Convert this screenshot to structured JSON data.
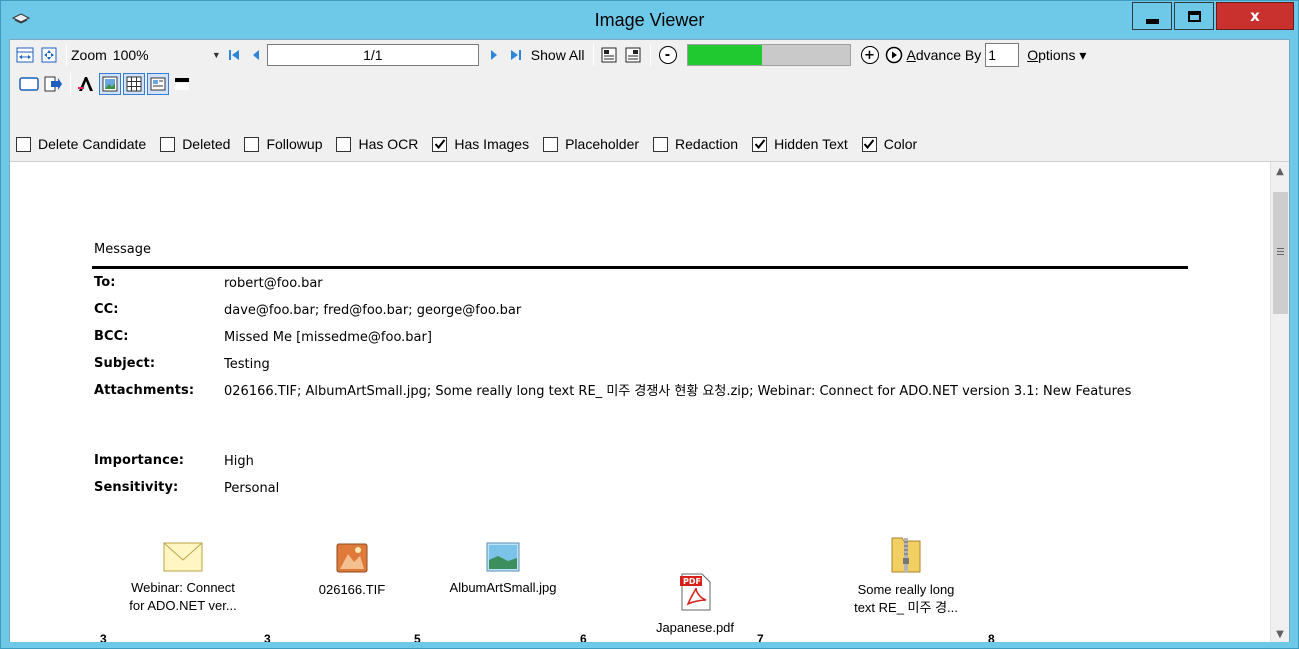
{
  "window": {
    "title": "Image Viewer",
    "close_glyph": "x"
  },
  "toolbar": {
    "zoom_label": "Zoom",
    "zoom_value": "100%",
    "page_value": "1/1",
    "show_all_label": "Show All",
    "zoom_out_glyph": "-",
    "zoom_in_glyph": "+",
    "progress_fraction": 0.46,
    "advance_label_first": "A",
    "advance_label_rest": "dvance By",
    "advance_value": "1",
    "options_label_first": "O",
    "options_label_rest": "ptions",
    "options_arrow": "▾"
  },
  "flags": [
    {
      "label": "Delete Candidate",
      "checked": false
    },
    {
      "label": "Deleted",
      "checked": false
    },
    {
      "label": "Followup",
      "checked": false
    },
    {
      "label": "Has OCR",
      "checked": false
    },
    {
      "label": "Has Images",
      "checked": true
    },
    {
      "label": "Placeholder",
      "checked": false
    },
    {
      "label": "Redaction",
      "checked": false
    },
    {
      "label": "Hidden Text",
      "checked": true
    },
    {
      "label": "Color",
      "checked": true
    }
  ],
  "message": {
    "title": "Message",
    "fields": [
      {
        "label": "To:",
        "value": "robert@foo.bar"
      },
      {
        "label": "CC:",
        "value": "dave@foo.bar; fred@foo.bar; george@foo.bar"
      },
      {
        "label": "BCC:",
        "value": "Missed Me [missedme@foo.bar]"
      },
      {
        "label": "Subject:",
        "value": "Testing"
      },
      {
        "label": "Attachments:",
        "value": "026166.TIF; AlbumArtSmall.jpg; Some really long text RE_ 미주 경쟁사 현황 요청.zip; Webinar: Connect for ADO.NET version 3.1: New Features"
      },
      {
        "label": "Importance:",
        "value": "High"
      },
      {
        "label": "Sensitivity:",
        "value": "Personal"
      }
    ]
  },
  "attachments": [
    {
      "name_line1": "Webinar: Connect",
      "name_line2": "for ADO.NET ver...",
      "icon": "envelope-icon",
      "num_left": "3",
      "num_right": "3"
    },
    {
      "name_line1": "026166.TIF",
      "name_line2": "",
      "icon": "tif-image-icon",
      "num_right": "5"
    },
    {
      "name_line1": "AlbumArtSmall.jpg",
      "name_line2": "",
      "icon": "jpg-image-icon",
      "num_right": "6"
    },
    {
      "name_line1": "Japanese.pdf",
      "name_line2": "",
      "icon": "pdf-icon",
      "num_right": "7"
    },
    {
      "name_line1": "Some really long",
      "name_line2": "text RE_ 미주 경...",
      "icon": "zip-folder-icon",
      "num_right": "8"
    }
  ],
  "colors": {
    "title_bar": "#6ec9e9",
    "close_button": "#c8312e",
    "progress_fill": "#20c92f",
    "nav_arrow": "#2e86d9"
  }
}
